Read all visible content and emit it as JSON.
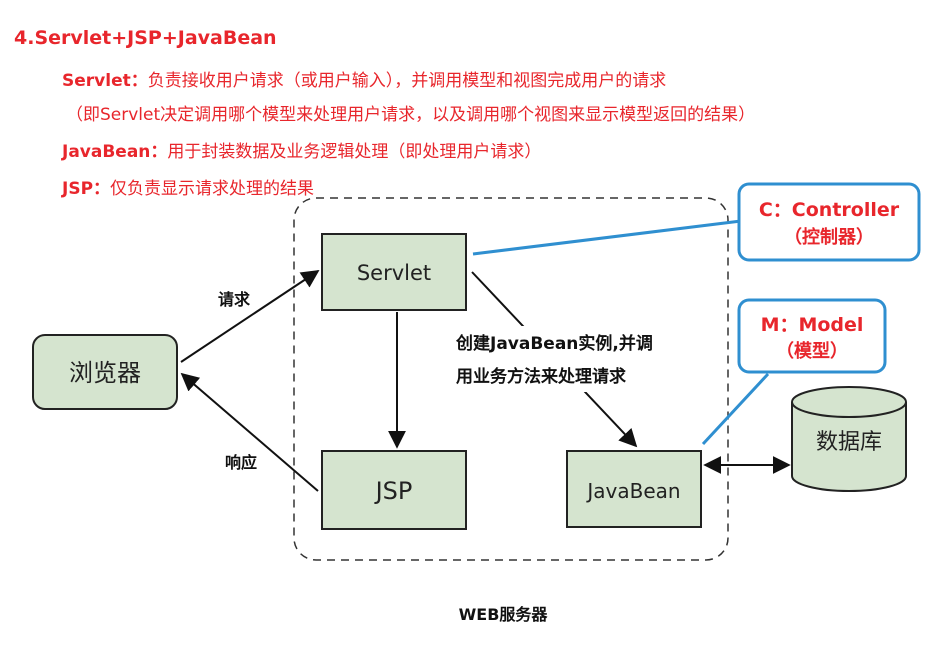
{
  "heading": "4.Servlet+JSP+JavaBean",
  "descriptions": [
    {
      "term": "Servlet：",
      "text": "负责接收用户请求（或用户输入），并调用模型和视图完成用户的请求"
    },
    {
      "term": "",
      "text": "（即Servlet决定调用哪个模型来处理用户请求，以及调用哪个视图来显示模型返回的结果）"
    },
    {
      "term": "JavaBean：",
      "text": "用于封装数据及业务逻辑处理（即处理用户请求）"
    },
    {
      "term": "JSP：",
      "text": "仅负责显示请求处理的结果"
    }
  ],
  "diagram": {
    "browser": "浏览器",
    "servlet": "Servlet",
    "jsp": "JSP",
    "javabean": "JavaBean",
    "database": "数据库",
    "request_label": "请求",
    "response_label": "响应",
    "create_line1": "创建JavaBean实例,并调",
    "create_line2": "用业务方法来处理请求",
    "server_label": "WEB服务器",
    "controller_line1": "C：Controller",
    "controller_line2": "（控制器）",
    "model_line1": "M：Model",
    "model_line2": "（模型）"
  },
  "colors": {
    "accent_red": "#e8262c",
    "box_fill": "#d5e4cf",
    "callout_blue": "#2f8fd0"
  }
}
